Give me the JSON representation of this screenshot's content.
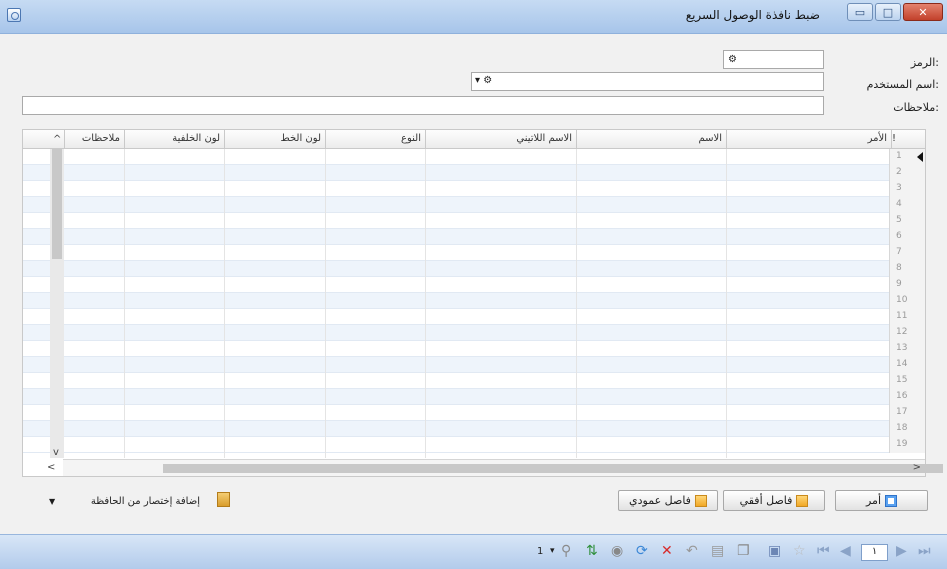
{
  "window": {
    "title": "ضبط نافذة الوصول السريع",
    "close_label": "✕",
    "maximize_label": "□",
    "minimize_label": "▭"
  },
  "form": {
    "code_label": "الرمز:",
    "user_label": "اسم المستخدم:",
    "notes_label": "ملاحظات:",
    "code_value": "",
    "user_value": "",
    "notes_value": ""
  },
  "grid": {
    "columns": [
      {
        "label": "!"
      },
      {
        "label": "الأمر"
      },
      {
        "label": "الاسم"
      },
      {
        "label": "الاسم اللاتيني"
      },
      {
        "label": "النوع"
      },
      {
        "label": "لون الخط"
      },
      {
        "label": "لون الخلفية"
      },
      {
        "label": "ملاحظات"
      }
    ],
    "row_numbers": [
      "1",
      "2",
      "3",
      "4",
      "5",
      "6",
      "7",
      "8",
      "9",
      "10",
      "11",
      "12",
      "13",
      "14",
      "15",
      "16",
      "17",
      "18",
      "19"
    ]
  },
  "buttons": {
    "command": "أمر",
    "horizontal": "فاصل أفقي",
    "vertical": "فاصل عمودي",
    "add_shortcut": "إضافة إختصار من الحافظة"
  },
  "navbar": {
    "page_value": "١",
    "left_count": "1"
  },
  "colors": {
    "title_bar": "#b7d0ef",
    "grid_alt_row": "#eef4fb",
    "close_button": "#d35a43"
  }
}
